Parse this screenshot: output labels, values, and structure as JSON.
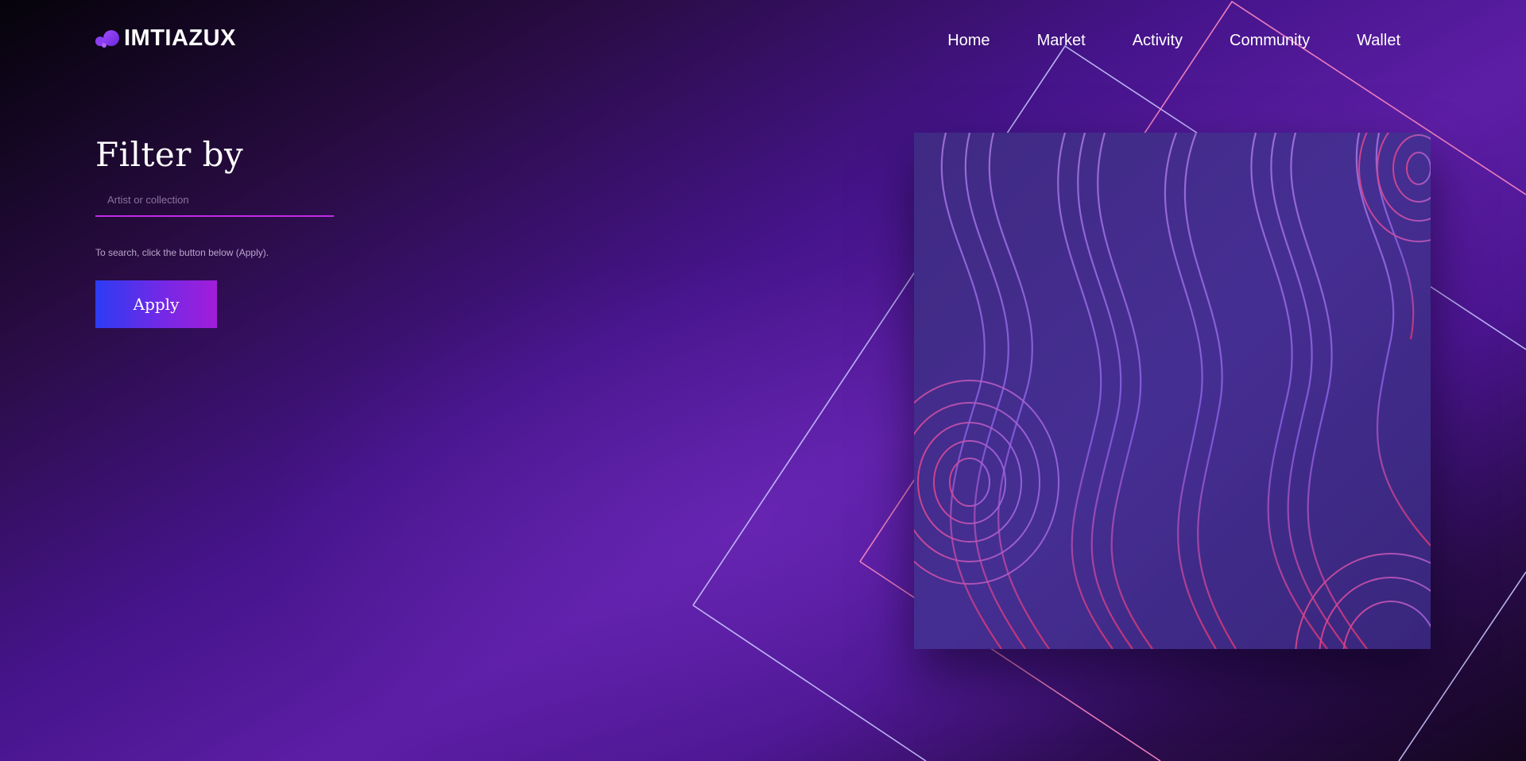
{
  "brand": {
    "name": "IMTIAZUX",
    "logo_icon": "bubbles-logo-icon"
  },
  "nav": {
    "items": [
      {
        "label": "Home"
      },
      {
        "label": "Market"
      },
      {
        "label": "Activity"
      },
      {
        "label": "Community"
      },
      {
        "label": "Wallet"
      }
    ]
  },
  "filter": {
    "title": "Filter by",
    "search_placeholder": "Artist or collection",
    "search_value": "",
    "hint": "To search, click the button below (Apply).",
    "apply_label": "Apply"
  },
  "artwork": {
    "description_icon": "abstract-wave-art"
  },
  "colors": {
    "accent_pink": "#c12be6",
    "button_gradient_start": "#2b3cf3",
    "button_gradient_end": "#a21dd9",
    "background_purple": "#5d1ea6",
    "line_light": "#c8c4ff",
    "line_pink": "#ff7ab8"
  }
}
